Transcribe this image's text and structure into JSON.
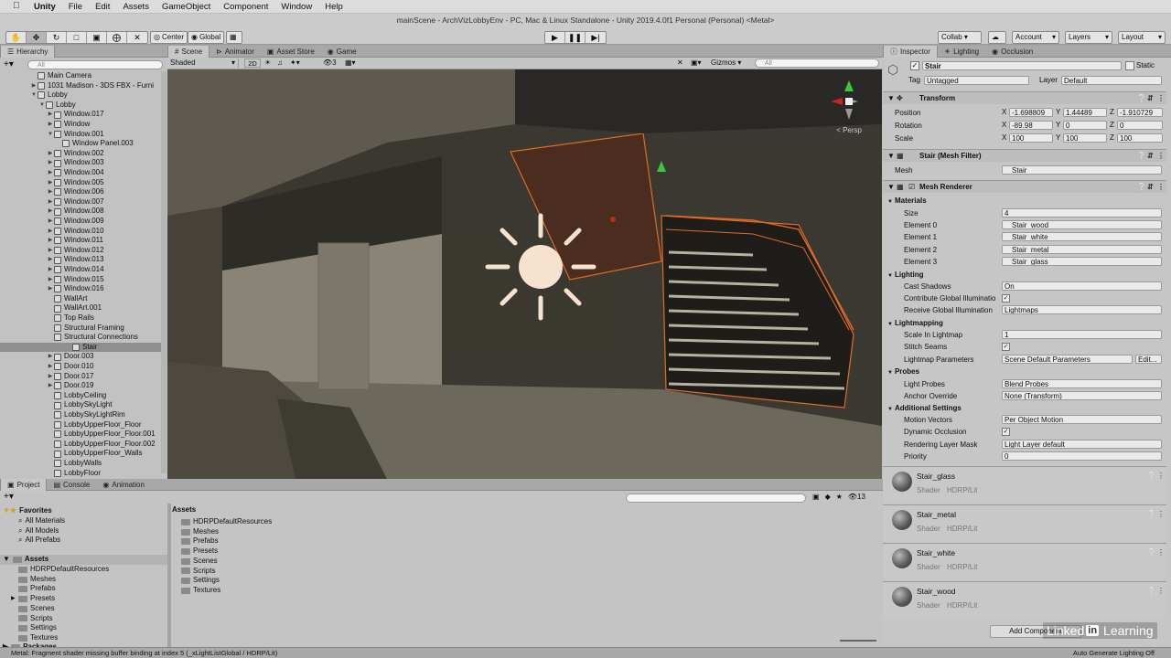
{
  "menubar": {
    "apple": "",
    "app": "Unity",
    "items": [
      "File",
      "Edit",
      "Assets",
      "GameObject",
      "Component",
      "Window",
      "Help"
    ]
  },
  "window_title": "mainScene - ArchVizLobbyEnv - PC, Mac & Linux Standalone - Unity 2019.4.0f1 Personal (Personal) <Metal>",
  "toolbar": {
    "pivot": "Center",
    "space": "Global",
    "collab": "Collab ▾",
    "account": "Account",
    "layers": "Layers",
    "layout": "Layout"
  },
  "hierarchy": {
    "tab": "Hierarchy",
    "search_placeholder": "All",
    "rows": [
      {
        "label": "Main Camera",
        "indent": 0,
        "arrow": ""
      },
      {
        "label": "1031 Madison - 3DS FBX - Furni",
        "indent": 0,
        "arrow": "▶"
      },
      {
        "label": "Lobby",
        "indent": 0,
        "arrow": "▼"
      },
      {
        "label": "Lobby",
        "indent": 1,
        "arrow": "▼"
      },
      {
        "label": "Window.017",
        "indent": 2,
        "arrow": "▶"
      },
      {
        "label": "Window",
        "indent": 2,
        "arrow": "▶"
      },
      {
        "label": "Window.001",
        "indent": 2,
        "arrow": "▼"
      },
      {
        "label": "Window Panel.003",
        "indent": 3,
        "arrow": ""
      },
      {
        "label": "Window.002",
        "indent": 2,
        "arrow": "▶"
      },
      {
        "label": "Window.003",
        "indent": 2,
        "arrow": "▶"
      },
      {
        "label": "Window.004",
        "indent": 2,
        "arrow": "▶"
      },
      {
        "label": "Window.005",
        "indent": 2,
        "arrow": "▶"
      },
      {
        "label": "Window.006",
        "indent": 2,
        "arrow": "▶"
      },
      {
        "label": "Window.007",
        "indent": 2,
        "arrow": "▶"
      },
      {
        "label": "Window.008",
        "indent": 2,
        "arrow": "▶"
      },
      {
        "label": "Window.009",
        "indent": 2,
        "arrow": "▶"
      },
      {
        "label": "Window.010",
        "indent": 2,
        "arrow": "▶"
      },
      {
        "label": "Window.011",
        "indent": 2,
        "arrow": "▶"
      },
      {
        "label": "Window.012",
        "indent": 2,
        "arrow": "▶"
      },
      {
        "label": "Window.013",
        "indent": 2,
        "arrow": "▶"
      },
      {
        "label": "Window.014",
        "indent": 2,
        "arrow": "▶"
      },
      {
        "label": "Window.015",
        "indent": 2,
        "arrow": "▶"
      },
      {
        "label": "Window.016",
        "indent": 2,
        "arrow": "▶"
      },
      {
        "label": "WallArt",
        "indent": 2,
        "arrow": ""
      },
      {
        "label": "WallArt.001",
        "indent": 2,
        "arrow": ""
      },
      {
        "label": "Top Rails",
        "indent": 2,
        "arrow": ""
      },
      {
        "label": "Structural Framing",
        "indent": 2,
        "arrow": ""
      },
      {
        "label": "Structural Connections",
        "indent": 2,
        "arrow": ""
      },
      {
        "label": "Stair",
        "indent": 2,
        "arrow": "",
        "selected": true
      },
      {
        "label": "Door.003",
        "indent": 2,
        "arrow": "▶"
      },
      {
        "label": "Door.010",
        "indent": 2,
        "arrow": "▶"
      },
      {
        "label": "Door.017",
        "indent": 2,
        "arrow": "▶"
      },
      {
        "label": "Door.019",
        "indent": 2,
        "arrow": "▶"
      },
      {
        "label": "LobbyCeiling",
        "indent": 2,
        "arrow": ""
      },
      {
        "label": "LobbySkyLight",
        "indent": 2,
        "arrow": ""
      },
      {
        "label": "LobbySkyLightRim",
        "indent": 2,
        "arrow": ""
      },
      {
        "label": "LobbyUpperFloor_Floor",
        "indent": 2,
        "arrow": ""
      },
      {
        "label": "LobbyUpperFloor_Floor.001",
        "indent": 2,
        "arrow": ""
      },
      {
        "label": "LobbyUpperFloor_Floor.002",
        "indent": 2,
        "arrow": ""
      },
      {
        "label": "LobbyUpperFloor_Walls",
        "indent": 2,
        "arrow": ""
      },
      {
        "label": "LobbyWalls",
        "indent": 2,
        "arrow": ""
      },
      {
        "label": "LobbyFloor",
        "indent": 2,
        "arrow": ""
      }
    ]
  },
  "scene": {
    "tabs": [
      "Scene",
      "Animator",
      "Asset Store",
      "Game"
    ],
    "shading": "Shaded",
    "mode_2d": "2D",
    "hidden_count": "3",
    "gizmos": "Gizmos",
    "search_placeholder": "All",
    "persp": "< Persp"
  },
  "inspector": {
    "tabs": [
      "Inspector",
      "Lighting",
      "Occlusion"
    ],
    "object_name": "Stair",
    "static_label": "Static",
    "tag_label": "Tag",
    "tag_value": "Untagged",
    "layer_label": "Layer",
    "layer_value": "Default",
    "transform": {
      "title": "Transform",
      "position_label": "Position",
      "rotation_label": "Rotation",
      "scale_label": "Scale",
      "position": {
        "x": "-1.698809",
        "y": "1.44489",
        "z": "-1.910729"
      },
      "rotation": {
        "x": "-89.98",
        "y": "0",
        "z": "0"
      },
      "scale": {
        "x": "100",
        "y": "100",
        "z": "100"
      }
    },
    "mesh_filter": {
      "title": "Stair (Mesh Filter)",
      "mesh_label": "Mesh",
      "mesh_value": "Stair"
    },
    "mesh_renderer": {
      "title": "Mesh Renderer",
      "materials_label": "Materials",
      "size_label": "Size",
      "size_value": "4",
      "elements": [
        {
          "label": "Element 0",
          "value": "Stair_wood"
        },
        {
          "label": "Element 1",
          "value": "Stair_white"
        },
        {
          "label": "Element 2",
          "value": "Stair_metal"
        },
        {
          "label": "Element 3",
          "value": "Stair_glass"
        }
      ],
      "lighting_label": "Lighting",
      "cast_shadows_label": "Cast Shadows",
      "cast_shadows_value": "On",
      "contribute_gi_label": "Contribute Global Illuminatio",
      "receive_gi_label": "Receive Global Illumination",
      "receive_gi_value": "Lightmaps",
      "lightmapping_label": "Lightmapping",
      "scale_lightmap_label": "Scale In Lightmap",
      "scale_lightmap_value": "1",
      "stitch_seams_label": "Stitch Seams",
      "lightmap_params_label": "Lightmap Parameters",
      "lightmap_params_value": "Scene Default Parameters",
      "edit_label": "Edit...",
      "probes_label": "Probes",
      "light_probes_label": "Light Probes",
      "light_probes_value": "Blend Probes",
      "anchor_override_label": "Anchor Override",
      "anchor_override_value": "None (Transform)",
      "additional_label": "Additional Settings",
      "motion_vectors_label": "Motion Vectors",
      "motion_vectors_value": "Per Object Motion",
      "dynamic_occlusion_label": "Dynamic Occlusion",
      "rendering_layer_label": "Rendering Layer Mask",
      "rendering_layer_value": "Light Layer default",
      "priority_label": "Priority",
      "priority_value": "0"
    },
    "materials": [
      {
        "name": "Stair_glass",
        "shader_label": "Shader",
        "shader": "HDRP/Lit"
      },
      {
        "name": "Stair_metal",
        "shader_label": "Shader",
        "shader": "HDRP/Lit"
      },
      {
        "name": "Stair_white",
        "shader_label": "Shader",
        "shader": "HDRP/Lit"
      },
      {
        "name": "Stair_wood",
        "shader_label": "Shader",
        "shader": "HDRP/Lit"
      }
    ],
    "add_component": "Add Component"
  },
  "project": {
    "tabs": [
      "Project",
      "Console",
      "Animation"
    ],
    "favorites_label": "Favorites",
    "favorites": [
      "All Materials",
      "All Models",
      "All Prefabs"
    ],
    "assets_label": "Assets",
    "tree": [
      "HDRPDefaultResources",
      "Meshes",
      "Prefabs",
      "Presets",
      "Scenes",
      "Scripts",
      "Settings",
      "Textures"
    ],
    "packages_label": "Packages",
    "count": "13",
    "breadcrumb": "Assets",
    "folders": [
      "HDRPDefaultResources",
      "Meshes",
      "Prefabs",
      "Presets",
      "Scenes",
      "Scripts",
      "Settings",
      "Textures"
    ]
  },
  "status": {
    "message": "Metal: Fragment shader missing buffer binding at index 5 (_xLightListGlobal / HDRP/Lit)",
    "right": "Auto Generate Lighting Off"
  },
  "watermark": {
    "linkedin": "Linked",
    "in": "in",
    "learning": "Learning"
  }
}
